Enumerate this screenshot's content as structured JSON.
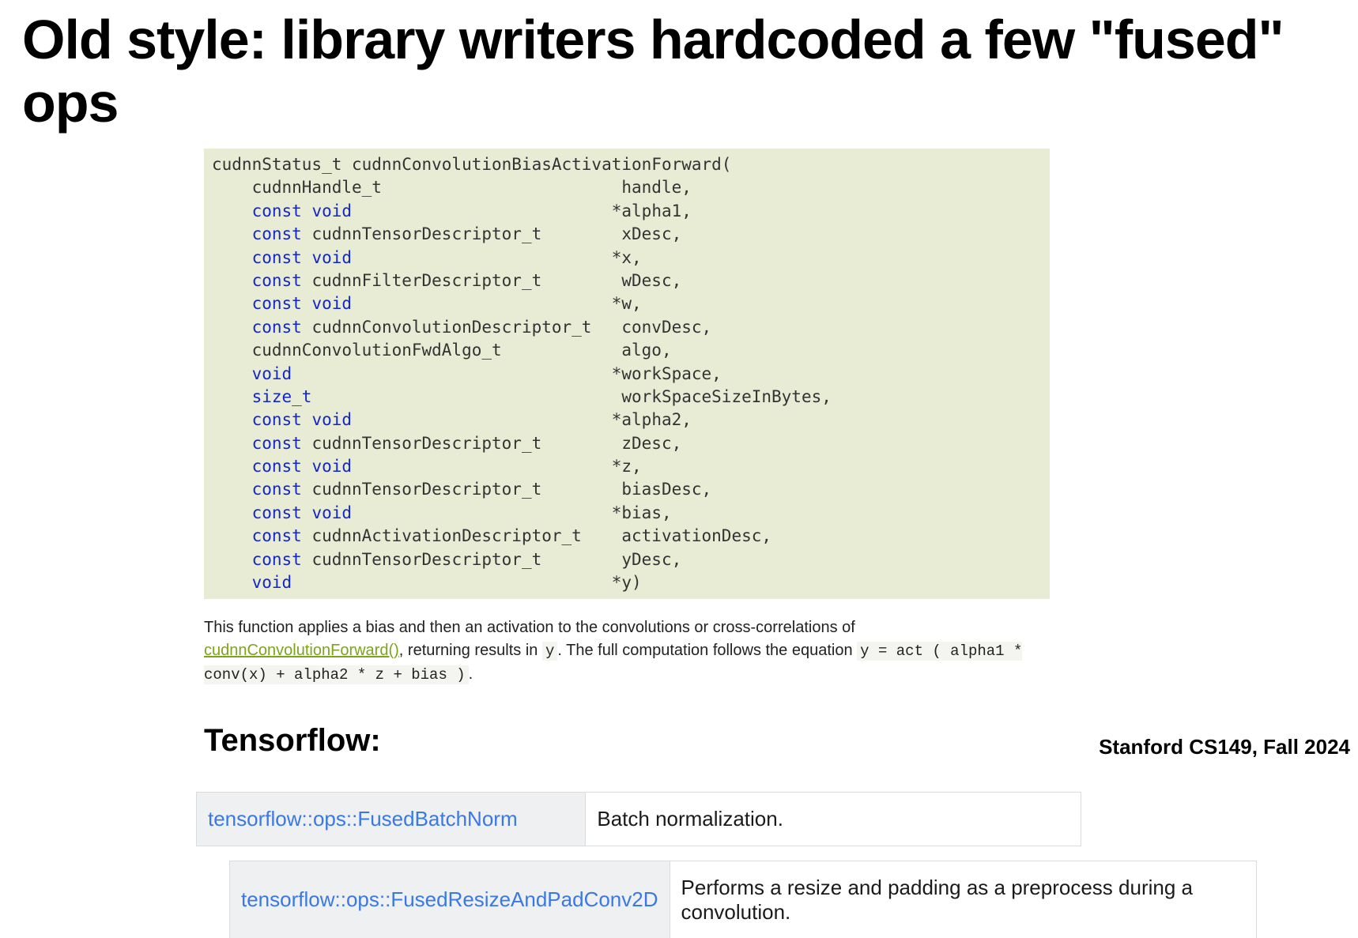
{
  "title": "Old style: library writers hardcoded a few \"fused\" ops",
  "code": {
    "return_type": "cudnnStatus_t",
    "function_name": "cudnnConvolutionBiasActivationForward",
    "params": [
      {
        "kw": "",
        "type": "cudnnHandle_t",
        "ptr": "",
        "name": "handle,"
      },
      {
        "kw": "const",
        "type": "void",
        "ptr": "*",
        "name": "alpha1,"
      },
      {
        "kw": "const",
        "type": "cudnnTensorDescriptor_t",
        "ptr": "",
        "name": "xDesc,"
      },
      {
        "kw": "const",
        "type": "void",
        "ptr": "*",
        "name": "x,"
      },
      {
        "kw": "const",
        "type": "cudnnFilterDescriptor_t",
        "ptr": "",
        "name": "wDesc,"
      },
      {
        "kw": "const",
        "type": "void",
        "ptr": "*",
        "name": "w,"
      },
      {
        "kw": "const",
        "type": "cudnnConvolutionDescriptor_t",
        "ptr": "",
        "name": "convDesc,"
      },
      {
        "kw": "",
        "type": "cudnnConvolutionFwdAlgo_t",
        "ptr": "",
        "name": "algo,"
      },
      {
        "kw": "",
        "type": "void",
        "ptr": "*",
        "name": "workSpace,"
      },
      {
        "kw": "",
        "type": "size_t",
        "ptr": "",
        "name": "workSpaceSizeInBytes,"
      },
      {
        "kw": "const",
        "type": "void",
        "ptr": "*",
        "name": "alpha2,"
      },
      {
        "kw": "const",
        "type": "cudnnTensorDescriptor_t",
        "ptr": "",
        "name": "zDesc,"
      },
      {
        "kw": "const",
        "type": "void",
        "ptr": "*",
        "name": "z,"
      },
      {
        "kw": "const",
        "type": "cudnnTensorDescriptor_t",
        "ptr": "",
        "name": "biasDesc,"
      },
      {
        "kw": "const",
        "type": "void",
        "ptr": "*",
        "name": "bias,"
      },
      {
        "kw": "const",
        "type": "cudnnActivationDescriptor_t",
        "ptr": "",
        "name": "activationDesc,"
      },
      {
        "kw": "const",
        "type": "cudnnTensorDescriptor_t",
        "ptr": "",
        "name": "yDesc,"
      },
      {
        "kw": "",
        "type": "void",
        "ptr": "*",
        "name": "y)"
      }
    ]
  },
  "description": {
    "prefix": "This function applies a bias and then an activation to the convolutions or cross-correlations of ",
    "link_text": "cudnnConvolutionForward()",
    "mid1": ", returning results in ",
    "y": "y",
    "mid2": ". The full computation follows the equation ",
    "equation": "y = act ( alpha1 * conv(x) + alpha2 * z + bias )",
    "suffix": "."
  },
  "tf_heading": "Tensorflow:",
  "tf_ops": [
    {
      "name": "tensorflow::ops::FusedBatchNorm",
      "desc": "Batch normalization."
    },
    {
      "name": "tensorflow::ops::FusedResizeAndPadConv2D",
      "desc": "Performs a resize and padding as a preprocess during a convolution."
    }
  ],
  "footer": "Stanford CS149, Fall 2024"
}
